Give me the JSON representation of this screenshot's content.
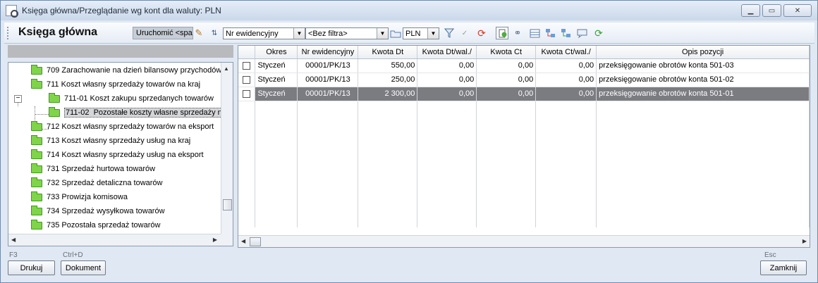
{
  "window": {
    "title": "Księga główna/Przeglądanie wg kont dla waluty: PLN",
    "minimize": "▁",
    "maximize": "▭",
    "close": "✕"
  },
  "toolbar": {
    "title": "Księga główna",
    "run_label": "Uruchomić <spa",
    "sort_combo": "Nr ewidencyjny",
    "filter_combo": "<Bez filtra>",
    "currency_combo": "PLN"
  },
  "tree": {
    "items": [
      {
        "code": "709",
        "label": "Zarachowanie na dzień bilansowy  przychodów"
      },
      {
        "code": "711",
        "label": "Koszt własny sprzedaży towarów na kraj"
      },
      {
        "code": "711-01",
        "label": "Koszt zakupu sprzedanych towarów"
      },
      {
        "code": "711-02",
        "label": "Pozostałe koszty własne sprzedaży na"
      },
      {
        "code": "712",
        "label": "Koszt własny sprzedaży towarów na eksport"
      },
      {
        "code": "713",
        "label": "Koszt własny sprzedaży usług na kraj"
      },
      {
        "code": "714",
        "label": "Koszt własny sprzedaży usług na eksport"
      },
      {
        "code": "731",
        "label": "Sprzedaż hurtowa towarów"
      },
      {
        "code": "732",
        "label": "Sprzedaż detaliczna towarów"
      },
      {
        "code": "733",
        "label": "Prowizja komisowa"
      },
      {
        "code": "734",
        "label": "Sprzedaż wysyłkowa towarów"
      },
      {
        "code": "735",
        "label": "Pozostała sprzedaż towarów"
      }
    ],
    "expander_minus": "−"
  },
  "grid": {
    "columns": [
      "Okres",
      "Nr ewidencyjny",
      "Kwota Dt",
      "Kwota Dt/wal./",
      "Kwota Ct",
      "Kwota Ct/wal./",
      "Opis pozycji"
    ],
    "rows": [
      [
        "Styczeń",
        "00001/PK/13",
        "550,00",
        "0,00",
        "0,00",
        "0,00",
        "przeksięgowanie obrotów konta 501-03"
      ],
      [
        "Styczeń",
        "00001/PK/13",
        "250,00",
        "0,00",
        "0,00",
        "0,00",
        "przeksięgowanie obrotów konta 501-02"
      ],
      [
        "Styczeń",
        "00001/PK/13",
        "2 300,00",
        "0,00",
        "0,00",
        "0,00",
        "przeksięgowanie obrotów konta 501-01"
      ]
    ]
  },
  "footer": {
    "print_shortcut": "F3",
    "print_label": "Drukuj",
    "doc_shortcut": "Ctrl+D",
    "doc_label": "Dokument",
    "close_shortcut": "Esc",
    "close_label": "Zamknij"
  }
}
